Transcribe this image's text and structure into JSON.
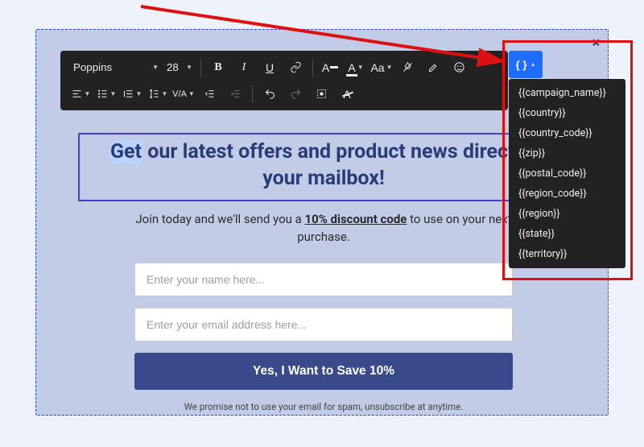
{
  "editor": {
    "close_label": "×",
    "headline_selected_word": "Get",
    "headline_rest": " our latest offers and product news direct to your mailbox!",
    "subhead_pre": "Join today and we'll send you a ",
    "subhead_discount": "10% discount code",
    "subhead_post": " to use on your next purchase.",
    "name_placeholder": "Enter your name here...",
    "email_placeholder": "Enter your email address here...",
    "cta_label": "Yes, I Want to Save 10%",
    "fineprint": "We promise not to use your email for spam, unsubscribe at anytime."
  },
  "toolbar": {
    "font_family": "Poppins",
    "font_size": "28",
    "merge_icon": "{ }"
  },
  "merge_tags": [
    "{{campaign_name}}",
    "{{country}}",
    "{{country_code}}",
    "{{zip}}",
    "{{postal_code}}",
    "{{region_code}}",
    "{{region}}",
    "{{state}}",
    "{{territory}}"
  ],
  "annotation": {
    "color": "#d11"
  }
}
